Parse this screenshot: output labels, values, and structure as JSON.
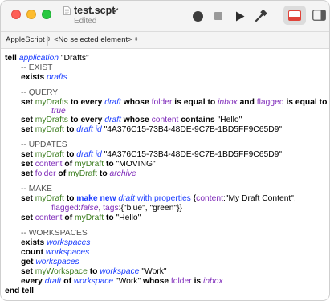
{
  "window": {
    "title": "test.scpt",
    "subtitle": "Edited"
  },
  "toolbar": {
    "record": "record-icon",
    "stop": "stop-icon",
    "run": "play-icon",
    "compile": "hammer-icon",
    "view": "view-layout-icon",
    "toggle": "sidebar-toggle-icon"
  },
  "navbar": {
    "language": "AppleScript",
    "element": "<No selected element>"
  },
  "code": {
    "l1": {
      "tell": "tell",
      "application": "application",
      "name": "\"Drafts\""
    },
    "c1": "-- EXIST",
    "l2": {
      "exists": "exists",
      "drafts": "drafts"
    },
    "c2": "-- QUERY",
    "l3": {
      "set": "set",
      "var": "myDrafts",
      "to": "to",
      "every": "every",
      "cls": "draft",
      "whose": "whose",
      "prop": "folder",
      "is": "is equal to",
      "val": "inbox",
      "and": "and",
      "prop2": "flagged",
      "is2": "is equal to"
    },
    "l3b": {
      "val": "true"
    },
    "l4": {
      "set": "set",
      "var": "myDrafts",
      "to": "to",
      "every": "every",
      "cls": "draft",
      "whose": "whose",
      "prop": "content",
      "contains": "contains",
      "str": "\"Hello\""
    },
    "l5": {
      "set": "set",
      "var": "myDraft",
      "to": "to",
      "cls": "draft id",
      "str": "\"4A376C15-73B4-48DE-9C7B-1BD5FF9C65D9\""
    },
    "c3": "-- UPDATES",
    "l6": {
      "set": "set",
      "var": "myDraft",
      "to": "to",
      "cls": "draft id",
      "str": "\"4A376C15-73B4-48DE-9C7B-1BD5FF9C65D9\""
    },
    "l7": {
      "set": "set",
      "prop": "content",
      "of": "of",
      "var": "myDraft",
      "to": "to",
      "str": "\"MOVING\""
    },
    "l8": {
      "set": "set",
      "prop": "folder",
      "of": "of",
      "var": "myDraft",
      "to": "to",
      "val": "archive"
    },
    "c4": "-- MAKE",
    "l9": {
      "set": "set",
      "var": "myDraft",
      "to": "to",
      "make": "make new",
      "cls": "draft",
      "with": "with properties",
      "open": "{",
      "p1": "content",
      "colon1": ":\"My Draft Content\","
    },
    "l9b": {
      "p2": "flagged",
      "colon2": ":",
      "v2": "false",
      "comma": ", ",
      "p3": "tags",
      "rest": ":{\"blue\", \"green\"}}"
    },
    "l10": {
      "set": "set",
      "prop": "content",
      "of": "of",
      "var": "myDraft",
      "to": "to",
      "str": "\"Hello\""
    },
    "c5": "-- WORKSPACES",
    "l11": {
      "exists": "exists",
      "cls": "workspaces"
    },
    "l12": {
      "count": "count",
      "cls": "workspaces"
    },
    "l13": {
      "get": "get",
      "cls": "workspaces"
    },
    "l14": {
      "set": "set",
      "var": "myWorkspace",
      "to": "to",
      "cls": "workspace",
      "str": "\"Work\""
    },
    "l15": {
      "every": "every",
      "cls": "draft",
      "of": "of",
      "cls2": "workspace",
      "str": "\"Work\"",
      "whose": "whose",
      "prop": "folder",
      "is": "is",
      "val": "inbox"
    },
    "l16": {
      "end": "end tell"
    }
  }
}
